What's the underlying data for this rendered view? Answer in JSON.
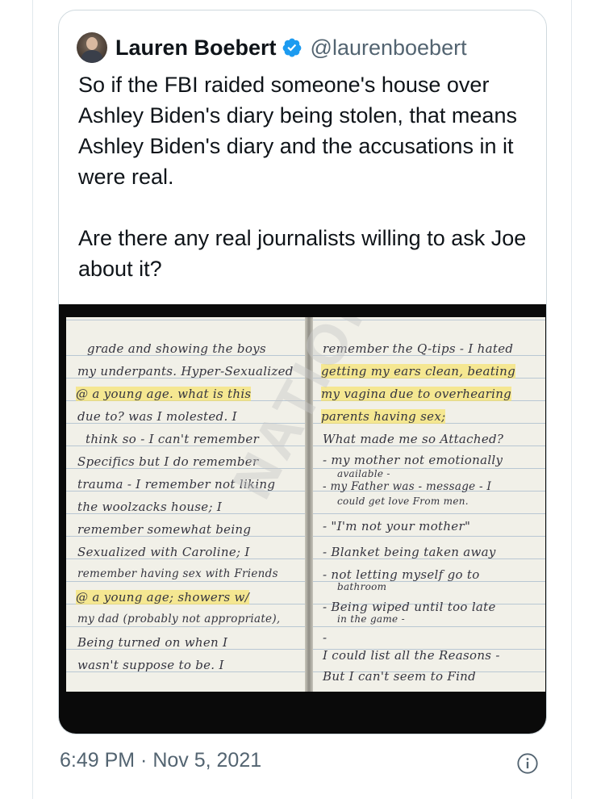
{
  "quoted_tweet": {
    "author_name": "Lauren Boebert",
    "author_handle": "@laurenboebert",
    "verified": true,
    "paragraphs": [
      "So if the FBI raided someone's house over Ashley Biden's diary being stolen, that means Ashley Biden's diary and the accusations in it were real.",
      "Are there any real journalists willing to ask Joe about it?"
    ]
  },
  "media": {
    "watermark": "NATIONAL FILE",
    "left_page_lines": [
      "grade and showing the boys",
      "my underpants. Hyper-Sexualized",
      "@ a young age. what is this",
      "due to? was I molested. I",
      "think so - I can't remember",
      "Specifics but I do remember",
      "trauma - I remember not liking",
      "the woolzacks house; I",
      "remember somewhat being",
      "Sexualized with Caroline; I",
      "remember having sex with Friends",
      "@ a young age; showers w/",
      "my dad (probably not appropriate),",
      "Being turned on when I",
      "wasn't suppose to be. I"
    ],
    "right_page_lines": [
      "remember the Q-tips - I hated",
      "getting my ears clean, beating",
      "my vagina due to overhearing",
      "parents having sex;",
      "What made me so Attached?",
      "- my mother not emotionally",
      "available -",
      "- my Father was - message - I",
      "could get love From men.",
      "- \"I'm not your mother\"",
      "- Blanket being taken away",
      "- not letting myself go to",
      "bathroom",
      "- Being wiped until too late",
      "in the game -",
      "-",
      "I could list all the Reasons -",
      "But I can't seem to Find"
    ],
    "highlight_color": "#f7e262"
  },
  "footer": {
    "timestamp": "6:49 PM · Nov 5, 2021"
  },
  "colors": {
    "verified_blue": "#1d9bf0",
    "text_primary": "#0f1419",
    "text_secondary": "#536471",
    "border": "#cfd9de"
  }
}
